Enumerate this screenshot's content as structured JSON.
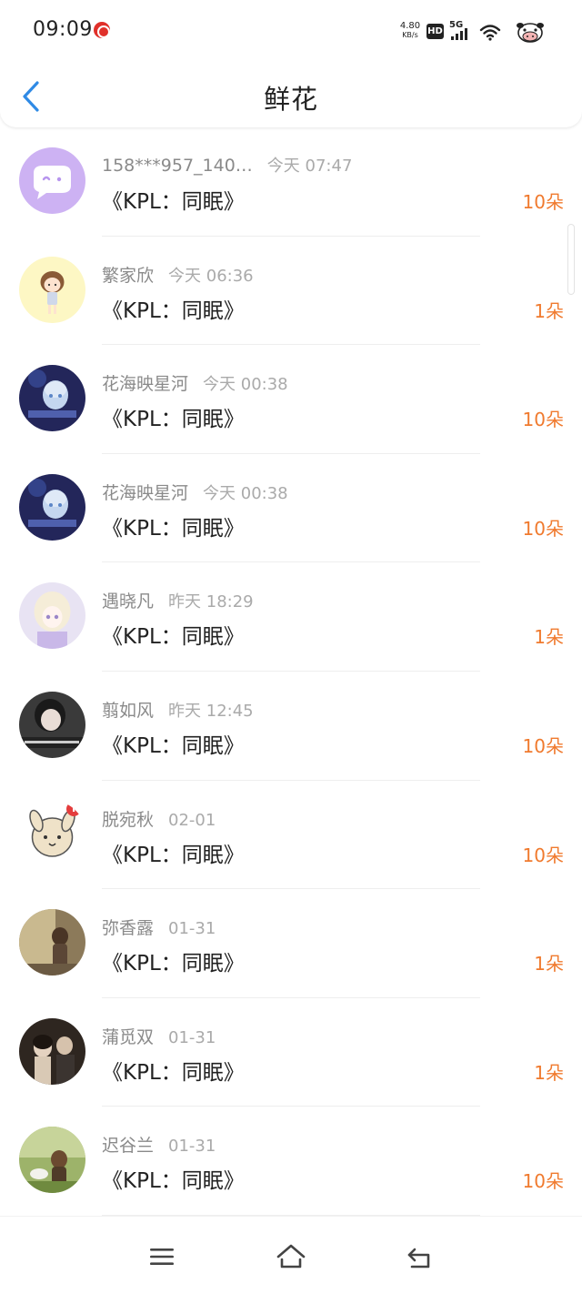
{
  "status_bar": {
    "time": "09:09",
    "speed_value": "4.80",
    "speed_unit": "KB/s",
    "hd_label": "HD",
    "network_label": "5G",
    "icons": [
      "netease-music-icon",
      "hd-icon",
      "signal-icon",
      "wifi-icon",
      "cow-avatar-icon"
    ]
  },
  "header": {
    "title": "鲜花",
    "back_icon": "chevron-left-icon"
  },
  "items": [
    {
      "name": "158***957_140…",
      "time": "今天 07:47",
      "work": "《KPL：同眠》",
      "count": "10朵"
    },
    {
      "name": "繁家欣",
      "time": "今天 06:36",
      "work": "《KPL：同眠》",
      "count": "1朵"
    },
    {
      "name": "花海映星河",
      "time": "今天 00:38",
      "work": "《KPL：同眠》",
      "count": "10朵"
    },
    {
      "name": "花海映星河",
      "time": "今天 00:38",
      "work": "《KPL：同眠》",
      "count": "10朵"
    },
    {
      "name": "遇晓凡",
      "time": "昨天 18:29",
      "work": "《KPL：同眠》",
      "count": "1朵"
    },
    {
      "name": "翦如风",
      "time": "昨天 12:45",
      "work": "《KPL：同眠》",
      "count": "10朵"
    },
    {
      "name": "脱宛秋",
      "time": "02-01",
      "work": "《KPL：同眠》",
      "count": "10朵"
    },
    {
      "name": "弥香露",
      "time": "01-31",
      "work": "《KPL：同眠》",
      "count": "1朵"
    },
    {
      "name": "蒲觅双",
      "time": "01-31",
      "work": "《KPL：同眠》",
      "count": "1朵"
    },
    {
      "name": "迟谷兰",
      "time": "01-31",
      "work": "《KPL：同眠》",
      "count": "10朵"
    }
  ],
  "colors": {
    "accent_blue": "#2f8ae5",
    "count_orange": "#f07a2e",
    "name_gray": "#8a8a8a",
    "time_gray": "#aaaaaa"
  },
  "system_nav": {
    "icons": [
      "menu-icon",
      "home-icon",
      "back-icon"
    ]
  }
}
